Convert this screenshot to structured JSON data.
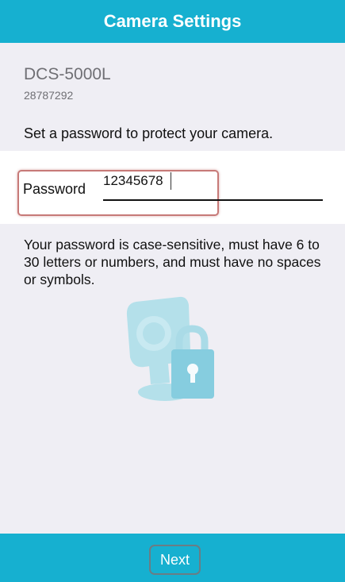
{
  "header": {
    "title": "Camera Settings"
  },
  "device": {
    "model": "DCS-5000L",
    "serial": "28787292"
  },
  "prompt": "Set a password to protect your camera.",
  "password_field": {
    "label": "Password",
    "value": "12345678"
  },
  "hint": "Your password is case-sensitive, must have 6 to 30 letters or numbers, and must have no spaces or symbols.",
  "illustration": {
    "icon": "camera-lock-icon"
  },
  "footer": {
    "next_label": "Next"
  },
  "colors": {
    "accent": "#16b0d0",
    "background": "#efeef4",
    "field_highlight": "#c77a78",
    "illustration": "#b4e0ea"
  }
}
